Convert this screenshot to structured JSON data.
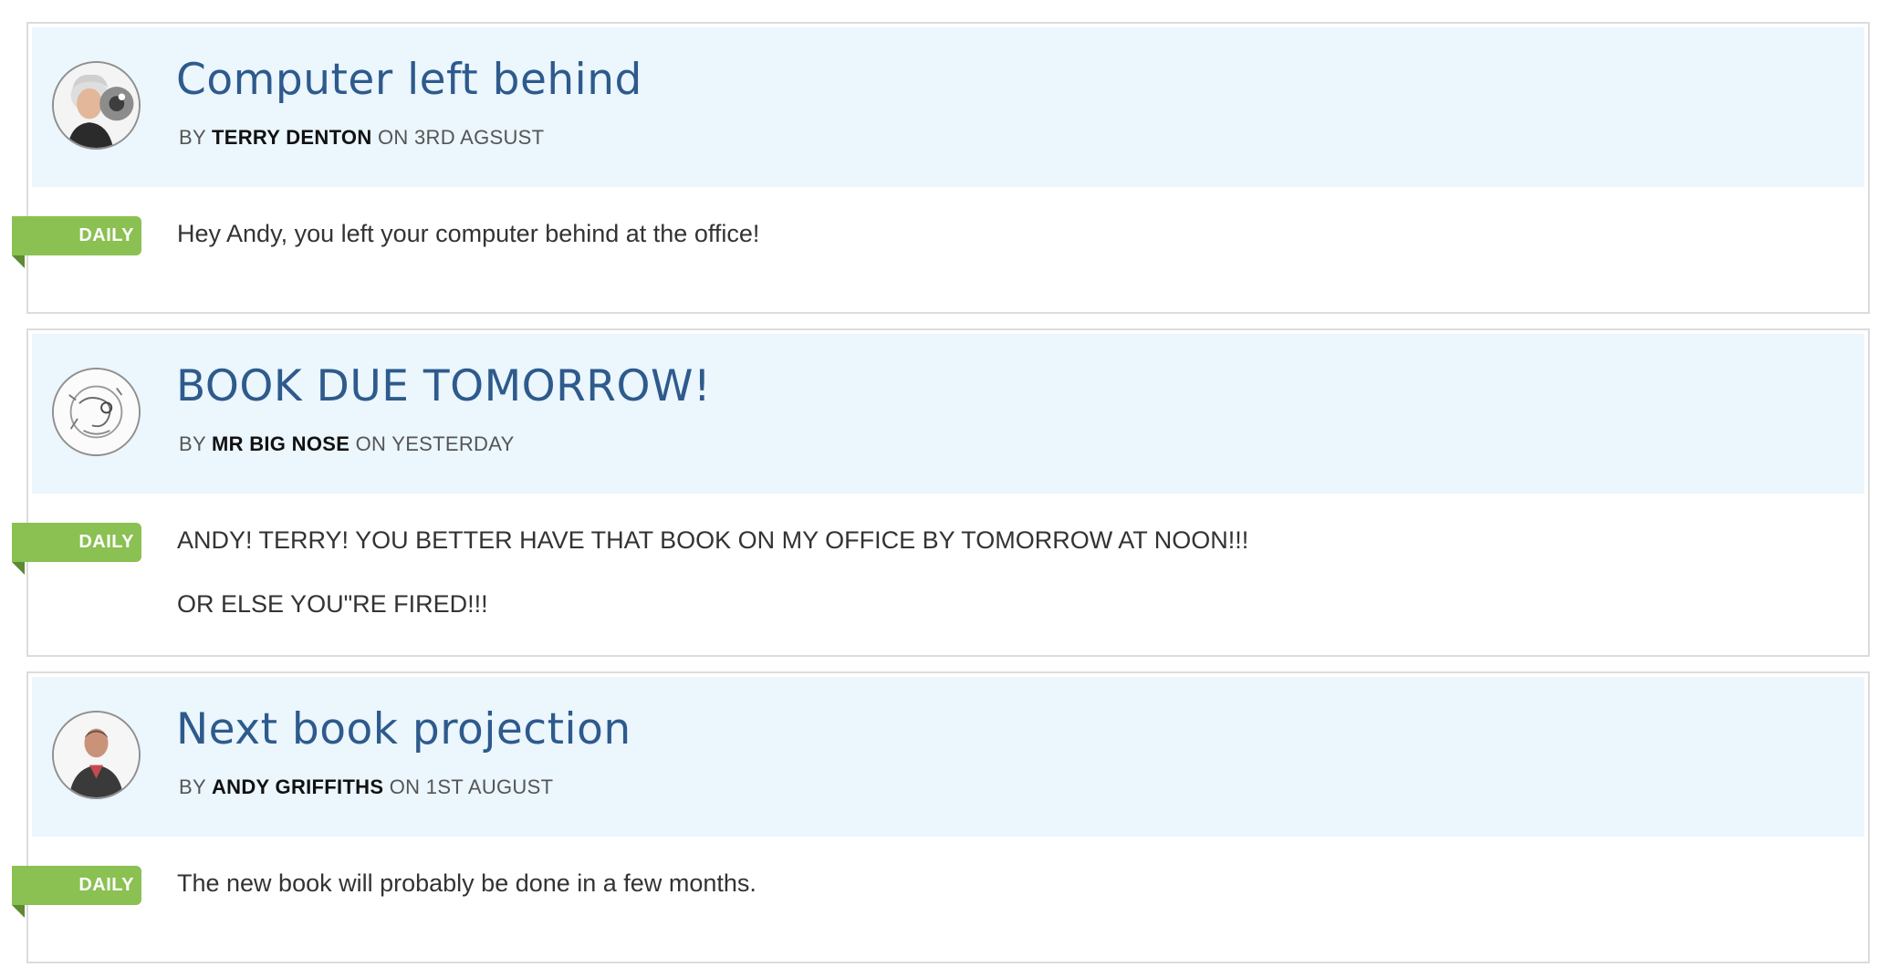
{
  "posts": [
    {
      "title": "Computer left behind",
      "by_label": "BY",
      "author": "TERRY DENTON",
      "on_label": "ON",
      "date": "3RD AGSUST",
      "tag": "DAILY",
      "body": [
        "Hey Andy, you left your computer behind at the office!"
      ]
    },
    {
      "title": "BOOK DUE TOMORROW!",
      "by_label": "BY",
      "author": "MR BIG NOSE",
      "on_label": "ON",
      "date": "YESTERDAY",
      "tag": "DAILY",
      "body": [
        "ANDY! TERRY! YOU BETTER HAVE THAT BOOK ON MY OFFICE BY TOMORROW AT NOON!!!",
        "OR ELSE YOU\"RE FIRED!!!"
      ]
    },
    {
      "title": "Next book projection",
      "by_label": "BY",
      "author": "ANDY GRIFFITHS",
      "on_label": "ON",
      "date": "1ST AUGUST",
      "tag": "DAILY",
      "body": [
        "The new book will probably be done in a few months."
      ]
    }
  ]
}
